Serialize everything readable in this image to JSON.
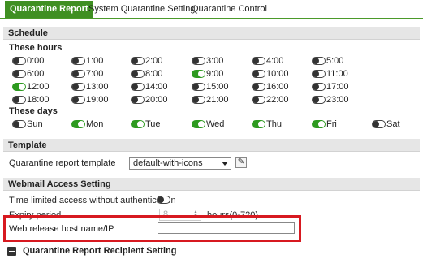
{
  "tabs": [
    {
      "label": "Quarantine Report",
      "active": true
    },
    {
      "label": "System Quarantine Setting",
      "active": false
    },
    {
      "label": "Quarantine Control",
      "active": false
    }
  ],
  "schedule": {
    "title": "Schedule",
    "hours_label": "These hours",
    "hours": [
      {
        "label": "0:00",
        "on": false
      },
      {
        "label": "1:00",
        "on": false
      },
      {
        "label": "2:00",
        "on": false
      },
      {
        "label": "3:00",
        "on": false
      },
      {
        "label": "4:00",
        "on": false
      },
      {
        "label": "5:00",
        "on": false
      },
      {
        "label": "6:00",
        "on": false
      },
      {
        "label": "7:00",
        "on": false
      },
      {
        "label": "8:00",
        "on": false
      },
      {
        "label": "9:00",
        "on": true
      },
      {
        "label": "10:00",
        "on": false
      },
      {
        "label": "11:00",
        "on": false
      },
      {
        "label": "12:00",
        "on": true
      },
      {
        "label": "13:00",
        "on": false
      },
      {
        "label": "14:00",
        "on": false
      },
      {
        "label": "15:00",
        "on": false
      },
      {
        "label": "16:00",
        "on": false
      },
      {
        "label": "17:00",
        "on": false
      },
      {
        "label": "18:00",
        "on": false
      },
      {
        "label": "19:00",
        "on": false
      },
      {
        "label": "20:00",
        "on": false
      },
      {
        "label": "21:00",
        "on": false
      },
      {
        "label": "22:00",
        "on": false
      },
      {
        "label": "23:00",
        "on": false
      }
    ],
    "days_label": "These days",
    "days": [
      {
        "label": "Sun",
        "on": false
      },
      {
        "label": "Mon",
        "on": true
      },
      {
        "label": "Tue",
        "on": true
      },
      {
        "label": "Wed",
        "on": true
      },
      {
        "label": "Thu",
        "on": true
      },
      {
        "label": "Fri",
        "on": true
      },
      {
        "label": "Sat",
        "on": false
      }
    ]
  },
  "template": {
    "title": "Template",
    "field_label": "Quarantine report template",
    "selected": "default-with-icons",
    "edit_icon": "edit-icon"
  },
  "webmail": {
    "title": "Webmail Access Setting",
    "time_limited_label": "Time limited access without authentication",
    "time_limited_on": false,
    "expiry_label": "Expiry period",
    "expiry_value": "8",
    "expiry_unit": "hours(0-720)",
    "host_label": "Web release host name/IP",
    "host_value": ""
  },
  "recipient": {
    "title": "Quarantine Report Recipient Setting",
    "icon": "collapse-icon"
  },
  "colors": {
    "accent": "#3f8f22",
    "toggle_on": "#2d9a1f",
    "highlight": "#d71920"
  }
}
